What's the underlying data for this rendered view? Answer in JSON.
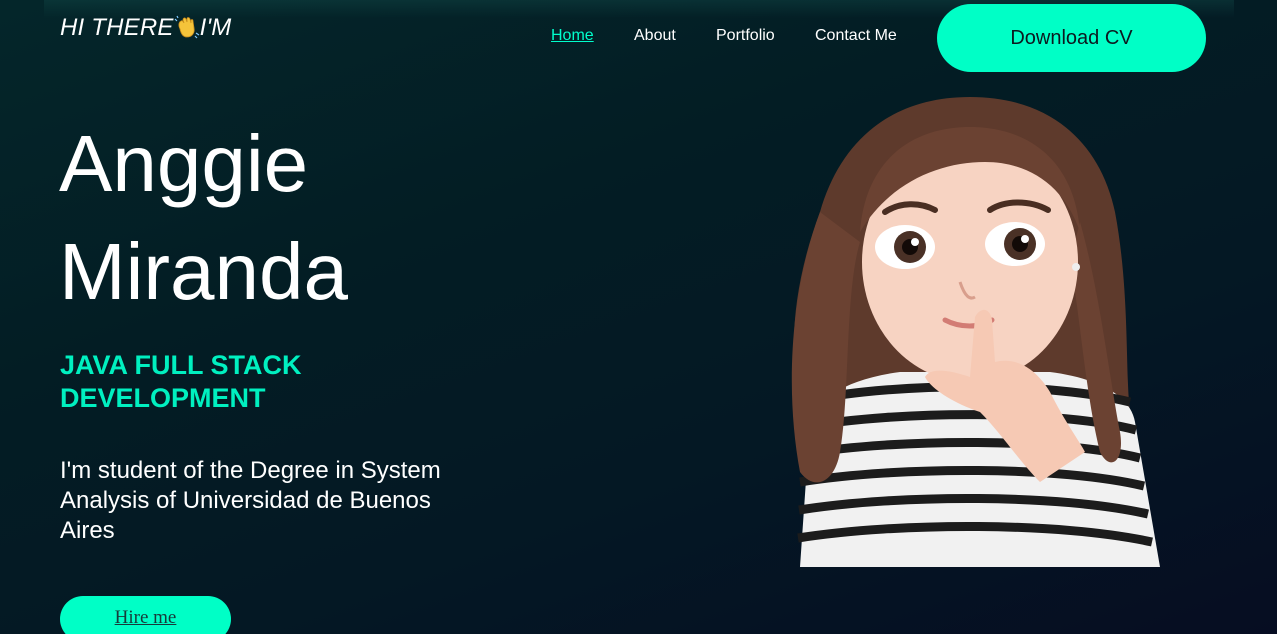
{
  "header": {
    "greeting_prefix": "HI THERE",
    "greeting_suffix": "I'M",
    "wave_icon": "waving-hand-icon"
  },
  "nav": {
    "items": [
      {
        "label": "Home",
        "active": true
      },
      {
        "label": "About",
        "active": false
      },
      {
        "label": "Portfolio",
        "active": false
      },
      {
        "label": "Contact Me",
        "active": false
      }
    ],
    "cv_button": "Download CV"
  },
  "hero": {
    "name_first": "Anggie",
    "name_last": "Miranda",
    "role": "JAVA FULL STACK DEVELOPMENT",
    "bio": "I'm student of the Degree in System Analysis of Universidad de Buenos Aires",
    "hire_button": "Hire me"
  },
  "colors": {
    "accent": "#00ffc6",
    "active_link": "#00ffcc",
    "role_text": "#00f0c0",
    "background_dark": "#031d24"
  }
}
